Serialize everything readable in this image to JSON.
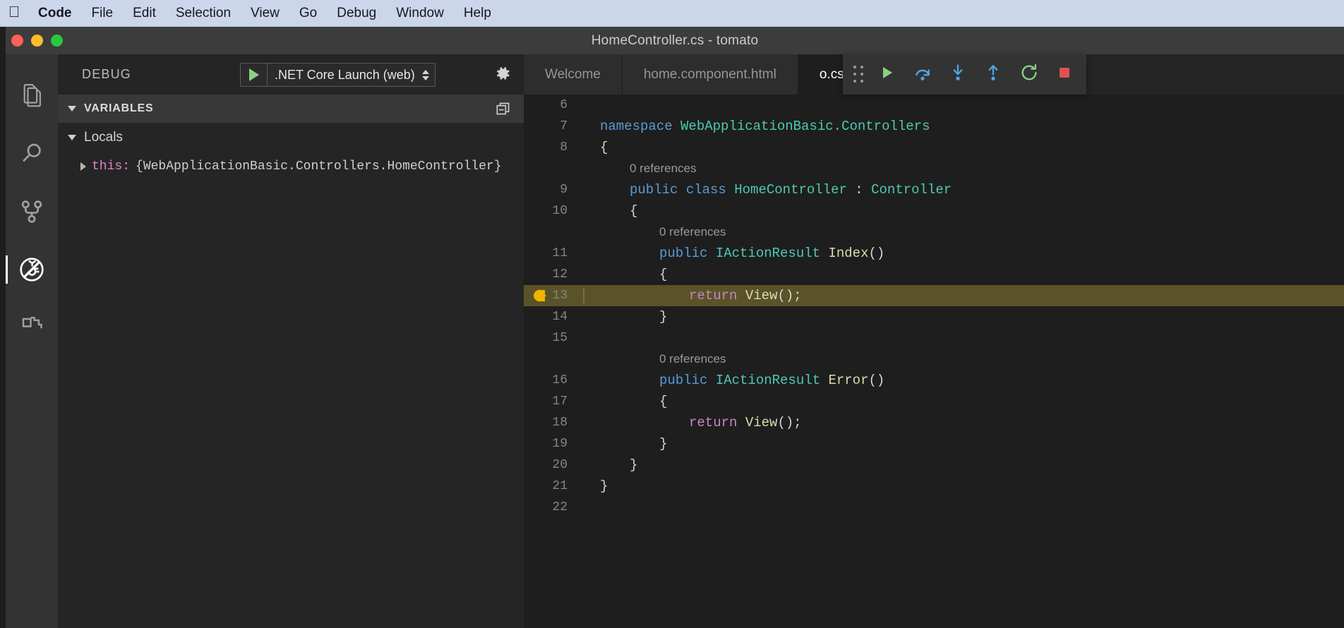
{
  "menubar": {
    "apple_icon": "apple-logo",
    "items": [
      {
        "label": "Code",
        "bold": true
      },
      {
        "label": "File",
        "bold": false
      },
      {
        "label": "Edit",
        "bold": false
      },
      {
        "label": "Selection",
        "bold": false
      },
      {
        "label": "View",
        "bold": false
      },
      {
        "label": "Go",
        "bold": false
      },
      {
        "label": "Debug",
        "bold": false
      },
      {
        "label": "Window",
        "bold": false
      },
      {
        "label": "Help",
        "bold": false
      }
    ]
  },
  "window": {
    "title": "HomeController.cs - tomato",
    "traffic_lights": {
      "close_color": "#ff5f57",
      "minimize_color": "#febc2e",
      "zoom_color": "#28c840"
    }
  },
  "activitybar": {
    "items": [
      {
        "name": "explorer-icon",
        "active": false
      },
      {
        "name": "search-icon",
        "active": false
      },
      {
        "name": "source-control-icon",
        "active": false
      },
      {
        "name": "debug-icon",
        "active": true
      },
      {
        "name": "extensions-icon",
        "active": false
      }
    ]
  },
  "sidebar": {
    "title": "DEBUG",
    "launch_configuration": ".NET Core Launch (web)",
    "start_debug_icon": "play-icon",
    "settings_icon": "gear-icon",
    "open_console_icon": "terminal-icon",
    "sections": [
      {
        "label": "VARIABLES",
        "collapsed": false,
        "action_icon": "copy-all-icon",
        "scopes": [
          {
            "label": "Locals",
            "collapsed": false,
            "variables": [
              {
                "name": "this:",
                "value": "{WebApplicationBasic.Controllers.HomeController}",
                "expandable": true
              }
            ]
          }
        ]
      }
    ]
  },
  "editor": {
    "tabs": [
      {
        "label": "Welcome",
        "active": false
      },
      {
        "label": "home.component.html",
        "active": false
      },
      {
        "label": "o.cs",
        "active": true
      }
    ],
    "debug_toolbar": {
      "grip_icon": "drag-handle-icon",
      "buttons": [
        {
          "name": "continue-button",
          "icon": "play-icon",
          "color": "#89d185"
        },
        {
          "name": "step-over-button",
          "icon": "step-over-icon",
          "color": "#4ea6e0"
        },
        {
          "name": "step-into-button",
          "icon": "step-into-icon",
          "color": "#4ea6e0"
        },
        {
          "name": "step-out-button",
          "icon": "step-out-icon",
          "color": "#4ea6e0"
        },
        {
          "name": "restart-button",
          "icon": "restart-icon",
          "color": "#89d185"
        },
        {
          "name": "stop-button",
          "icon": "stop-icon",
          "color": "#e05252"
        }
      ]
    },
    "breakpoint": {
      "line": 13,
      "color": "#e51400"
    },
    "highlighted_line": 13,
    "lines": [
      {
        "number": "6",
        "tokens": []
      },
      {
        "number": "7",
        "tokens": [
          {
            "t": "namespace ",
            "c": "kw"
          },
          {
            "t": "WebApplicationBasic.Controllers",
            "c": "typ"
          }
        ],
        "indent": 0
      },
      {
        "number": "8",
        "tokens": [
          {
            "t": "{",
            "c": "pln"
          }
        ],
        "indent": 0
      },
      {
        "number": "",
        "codelens": "0 references",
        "indent": 1
      },
      {
        "number": "9",
        "tokens": [
          {
            "t": "public ",
            "c": "kw"
          },
          {
            "t": "class ",
            "c": "kw"
          },
          {
            "t": "HomeController",
            "c": "typ"
          },
          {
            "t": " : ",
            "c": "pln"
          },
          {
            "t": "Controller",
            "c": "typ"
          }
        ],
        "indent": 1
      },
      {
        "number": "10",
        "tokens": [
          {
            "t": "{",
            "c": "pln"
          }
        ],
        "indent": 1
      },
      {
        "number": "",
        "codelens": "0 references",
        "indent": 2
      },
      {
        "number": "11",
        "tokens": [
          {
            "t": "public ",
            "c": "kw"
          },
          {
            "t": "IActionResult ",
            "c": "typ"
          },
          {
            "t": "Index",
            "c": "fn"
          },
          {
            "t": "()",
            "c": "pln"
          }
        ],
        "indent": 2
      },
      {
        "number": "12",
        "tokens": [
          {
            "t": "{",
            "c": "pln"
          }
        ],
        "indent": 2
      },
      {
        "number": "13",
        "tokens": [
          {
            "t": "return ",
            "c": "ctl"
          },
          {
            "t": "View",
            "c": "fn"
          },
          {
            "t": "();",
            "c": "pln"
          }
        ],
        "indent": 3,
        "highlight": true,
        "breakpoint": true
      },
      {
        "number": "14",
        "tokens": [
          {
            "t": "}",
            "c": "pln"
          }
        ],
        "indent": 2
      },
      {
        "number": "15",
        "tokens": []
      },
      {
        "number": "",
        "codelens": "0 references",
        "indent": 2
      },
      {
        "number": "16",
        "tokens": [
          {
            "t": "public ",
            "c": "kw"
          },
          {
            "t": "IActionResult ",
            "c": "typ"
          },
          {
            "t": "Error",
            "c": "fn"
          },
          {
            "t": "()",
            "c": "pln"
          }
        ],
        "indent": 2
      },
      {
        "number": "17",
        "tokens": [
          {
            "t": "{",
            "c": "pln"
          }
        ],
        "indent": 2
      },
      {
        "number": "18",
        "tokens": [
          {
            "t": "return ",
            "c": "ctl"
          },
          {
            "t": "View",
            "c": "fn"
          },
          {
            "t": "();",
            "c": "pln"
          }
        ],
        "indent": 3
      },
      {
        "number": "19",
        "tokens": [
          {
            "t": "}",
            "c": "pln"
          }
        ],
        "indent": 2
      },
      {
        "number": "20",
        "tokens": [
          {
            "t": "}",
            "c": "pln"
          }
        ],
        "indent": 1
      },
      {
        "number": "21",
        "tokens": [
          {
            "t": "}",
            "c": "pln"
          }
        ],
        "indent": 0
      },
      {
        "number": "22",
        "tokens": []
      }
    ]
  },
  "colors": {
    "keyword": "#569cd6",
    "type": "#4ec9b0",
    "function": "#dcdcaa",
    "control": "#c586c0",
    "plain": "#d4d4d4",
    "codelens": "#999999",
    "editor_bg": "#1e1e1e",
    "sidebar_bg": "#252526",
    "activitybar_bg": "#333333",
    "highlight_bg": "#5a5329"
  }
}
